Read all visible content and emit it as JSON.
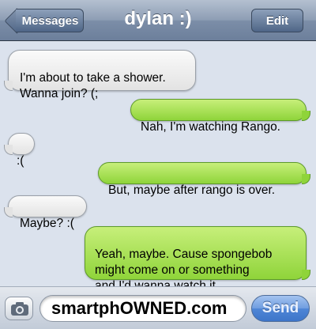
{
  "header": {
    "title": "dylan :)",
    "back_label": "Messages",
    "edit_label": "Edit"
  },
  "messages": [
    {
      "direction": "incoming",
      "text": "I'm about to take a shower.\nWanna join? (;"
    },
    {
      "direction": "outgoing",
      "text": "Nah, I'm watching Rango."
    },
    {
      "direction": "incoming",
      "text": ":("
    },
    {
      "direction": "outgoing",
      "text": "But, maybe after rango is over."
    },
    {
      "direction": "incoming",
      "text": "Maybe? :("
    },
    {
      "direction": "outgoing",
      "text": "Yeah, maybe. Cause spongebob\nmight come on or something\nand I'd wanna watch it."
    }
  ],
  "composer": {
    "camera_icon": "camera-icon",
    "input_value": "smartphOWNED.com",
    "send_label": "Send"
  },
  "colors": {
    "incoming_bubble": "#e3e3e3",
    "outgoing_bubble": "#8fd43a",
    "background": "#dbe2ed",
    "send_button": "#4f86d6"
  }
}
